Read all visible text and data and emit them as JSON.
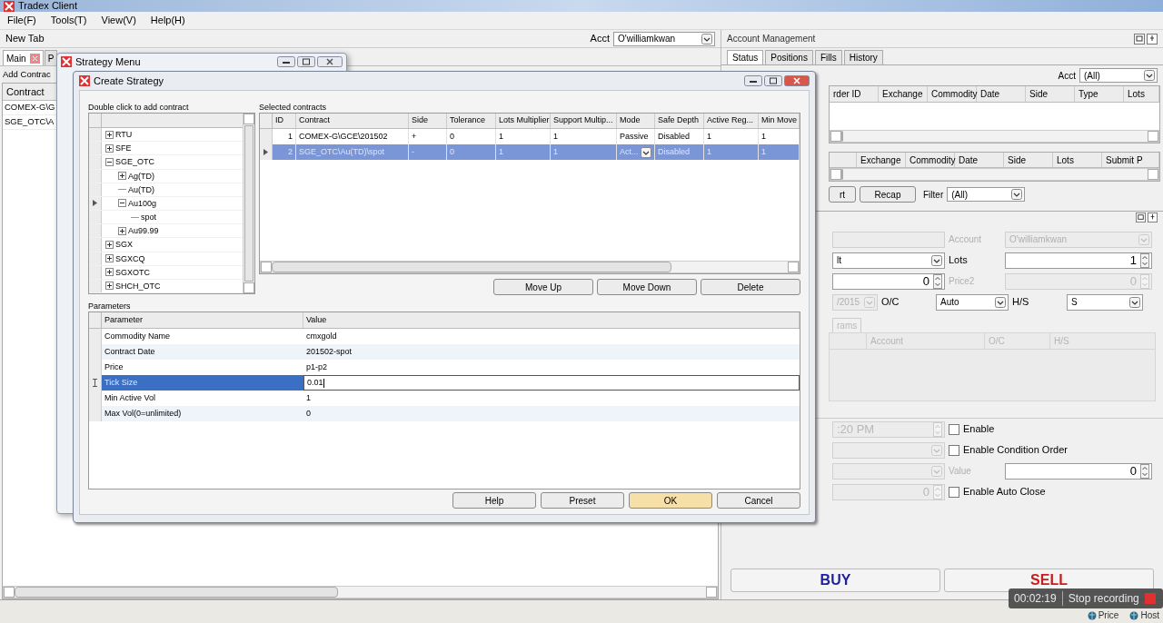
{
  "window": {
    "title": "Tradex Client"
  },
  "menu": [
    "File(F)",
    "Tools(T)",
    "View(V)",
    "Help(H)"
  ],
  "main": {
    "tab_label": "New Tab",
    "acct_label": "Acct",
    "acct_value": "O'williamkwan",
    "tabs": [
      {
        "label": "Main",
        "selected": true
      },
      {
        "label": "P",
        "selected": false
      }
    ],
    "add_button": "Add Contrac",
    "column": "Contract",
    "rows": [
      "COMEX-G\\G",
      "SGE_OTC\\A"
    ]
  },
  "account_management": {
    "title": "Account Management",
    "tabs": [
      {
        "label": "Status",
        "selected": true
      },
      {
        "label": "Positions",
        "selected": false
      },
      {
        "label": "Fills",
        "selected": false
      },
      {
        "label": "History",
        "selected": false
      }
    ],
    "acct_label": "Acct",
    "acct_value": "(All)",
    "orders_columns": [
      "rder ID",
      "Exchange",
      "Commodity",
      "Date",
      "Side",
      "Type",
      "Lots"
    ],
    "fills_columns": [
      "Exchange",
      "Commodity",
      "Date",
      "Side",
      "Lots",
      "Submit P"
    ],
    "buttons": [
      "rt",
      "Recap"
    ],
    "filter_label": "Filter",
    "filter_value": "(All)"
  },
  "order_entry": {
    "rows_top": [
      {
        "cells": [
          {
            "kind": "field",
            "disabled": true
          },
          {
            "kind": "label",
            "text": "Account",
            "disabled": true
          },
          {
            "kind": "select",
            "value": "O'williamkwan",
            "disabled": true
          }
        ]
      },
      {
        "cells": [
          {
            "kind": "select",
            "value": "lt",
            "disabled": false
          },
          {
            "kind": "label",
            "text": "Lots",
            "disabled": false
          },
          {
            "kind": "spinner",
            "value": "1",
            "disabled": false
          }
        ]
      },
      {
        "cells": [
          {
            "kind": "spinner",
            "value": "0",
            "disabled": false
          },
          {
            "kind": "label",
            "text": "Price2",
            "disabled": true
          },
          {
            "kind": "spinner",
            "value": "0",
            "disabled": true
          }
        ]
      },
      {
        "cells": [
          {
            "kind": "select",
            "value": "/2015",
            "disabled": true
          },
          {
            "kind": "label",
            "text": "O/C",
            "disabled": false
          },
          {
            "kind": "select",
            "value": "Auto",
            "disabled": false
          },
          {
            "kind": "label",
            "text": "H/S",
            "disabled": false
          },
          {
            "kind": "select",
            "value": "S",
            "disabled": false
          }
        ]
      }
    ],
    "params_tab": {
      "label": "rams",
      "disabled": true
    },
    "grid_columns": [
      "Account",
      "O/C",
      "H/S"
    ],
    "rows_bottom": [
      {
        "cells": [
          {
            "kind": "time",
            "value": ":20 PM",
            "disabled": true
          },
          {
            "kind": "checkbox",
            "label": "Enable",
            "checked": false
          }
        ]
      },
      {
        "cells": [
          {
            "kind": "select",
            "disabled": true
          },
          {
            "kind": "checkbox",
            "label": "Enable Condition Order",
            "checked": false
          }
        ]
      },
      {
        "cells": [
          {
            "kind": "select",
            "disabled": true
          },
          {
            "kind": "label",
            "text": "Value",
            "disabled": true
          },
          {
            "kind": "spinner",
            "value": "0",
            "disabled": false
          }
        ]
      },
      {
        "cells": [
          {
            "kind": "spinner",
            "value": "0",
            "disabled": true
          },
          {
            "kind": "checkbox",
            "label": "Enable Auto Close",
            "checked": false
          }
        ]
      }
    ],
    "buy": "BUY",
    "sell": "SELL"
  },
  "strategy_menu": {
    "title": "Strategy Menu"
  },
  "create_strategy": {
    "title": "Create Strategy",
    "tree_label": "Double click to add contract",
    "tree": [
      {
        "label": "RTU",
        "expanded": false,
        "selected": false
      },
      {
        "label": "SFE",
        "expanded": false,
        "selected": false
      },
      {
        "label": "SGE_OTC",
        "expanded": true,
        "selected": false,
        "children": [
          {
            "label": "Ag(TD)",
            "expanded": false,
            "selected": false
          },
          {
            "label": "Au(TD)",
            "selected": false
          },
          {
            "label": "Au100g",
            "expanded": true,
            "selected": true,
            "children": [
              {
                "label": "spot",
                "selected": false
              }
            ]
          },
          {
            "label": "Au99.99",
            "expanded": false,
            "selected": false
          }
        ]
      },
      {
        "label": "SGX",
        "expanded": false,
        "selected": false
      },
      {
        "label": "SGXCQ",
        "expanded": false,
        "selected": false
      },
      {
        "label": "SGXOTC",
        "expanded": false,
        "selected": false
      },
      {
        "label": "SHCH_OTC",
        "expanded": false,
        "selected": false
      }
    ],
    "contracts_label": "Selected contracts",
    "contract_columns": [
      "ID",
      "Contract",
      "Side",
      "Tolerance",
      "Lots Multiplier",
      "Support Multip...",
      "Mode",
      "Safe Depth",
      "Active Reg...",
      "Min Move"
    ],
    "contracts": [
      {
        "cells": [
          "1",
          "COMEX-G\\GCE\\201502",
          "+",
          "0",
          "1",
          "1",
          "Passive",
          "Disabled",
          "1",
          "1"
        ],
        "selected": false
      },
      {
        "cells": [
          "2",
          "SGE_OTC\\Au(TD)\\spot",
          "-",
          "0",
          "1",
          "1",
          "Act...",
          "Disabled",
          "1",
          "1"
        ],
        "selected": true
      }
    ],
    "list_buttons": [
      "Move Up",
      "Move Down",
      "Delete"
    ],
    "params_label": "Parameters",
    "param_columns": [
      "Parameter",
      "Value"
    ],
    "params": [
      {
        "name": "Commodity Name",
        "value": "cmxgold",
        "selected": false
      },
      {
        "name": "Contract Date",
        "value": "201502-spot",
        "selected": false
      },
      {
        "name": "Price",
        "value": "p1-p2",
        "selected": false
      },
      {
        "name": "Tick Size",
        "value": "0.01",
        "selected": true
      },
      {
        "name": "Min Active Vol",
        "value": "1",
        "selected": false
      },
      {
        "name": "Max Vol(0=unlimited)",
        "value": "0",
        "selected": false
      }
    ],
    "buttons": [
      {
        "label": "Help",
        "highlighted": false
      },
      {
        "label": "Preset",
        "highlighted": false
      },
      {
        "label": "OK",
        "highlighted": true
      },
      {
        "label": "Cancel",
        "highlighted": false
      }
    ]
  },
  "recording": {
    "time": "00:02:19",
    "action": "Stop recording"
  },
  "tray": [
    "Price",
    "Host"
  ]
}
